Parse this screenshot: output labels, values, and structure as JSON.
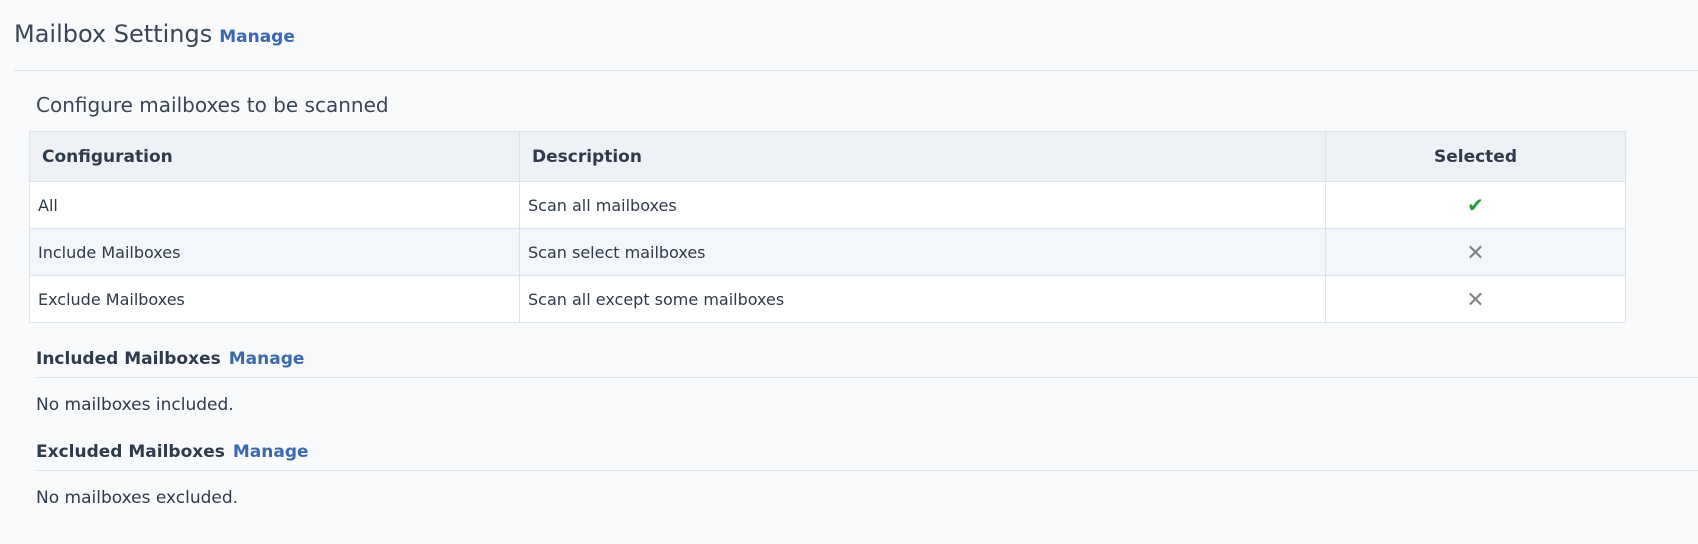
{
  "header": {
    "title": "Mailbox Settings",
    "manage_label": "Manage"
  },
  "config_section": {
    "title": "Configure mailboxes to be scanned",
    "columns": [
      "Configuration",
      "Description",
      "Selected"
    ],
    "rows": [
      {
        "configuration": "All",
        "description": "Scan all mailboxes",
        "selected": true,
        "selected_icon": "check-icon"
      },
      {
        "configuration": "Include Mailboxes",
        "description": "Scan select mailboxes",
        "selected": false,
        "selected_icon": "x-icon"
      },
      {
        "configuration": "Exclude Mailboxes",
        "description": "Scan all except some mailboxes",
        "selected": false,
        "selected_icon": "x-icon"
      }
    ]
  },
  "included": {
    "title": "Included Mailboxes",
    "manage_label": "Manage",
    "empty_text": "No mailboxes included."
  },
  "excluded": {
    "title": "Excluded Mailboxes",
    "manage_label": "Manage",
    "empty_text": "No mailboxes excluded."
  },
  "colors": {
    "link": "#3b69b0",
    "check": "#1e9e3c",
    "x_mark": "#808489",
    "header_bg": "#eef2f7"
  }
}
